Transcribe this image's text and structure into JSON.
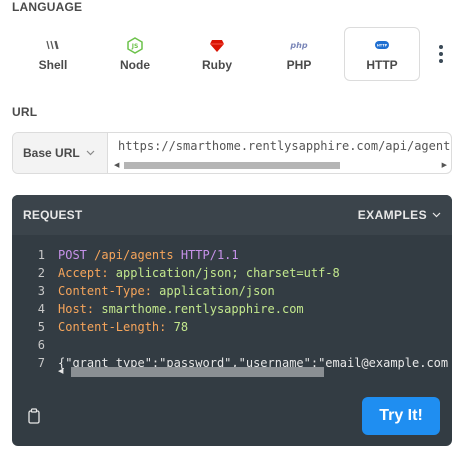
{
  "language_section": {
    "title": "LANGUAGE",
    "tabs": [
      {
        "label": "Shell",
        "icon": "shell-icon",
        "active": false
      },
      {
        "label": "Node",
        "icon": "nodejs-icon",
        "active": false
      },
      {
        "label": "Ruby",
        "icon": "ruby-icon",
        "active": false
      },
      {
        "label": "PHP",
        "icon": "php-icon",
        "active": false
      },
      {
        "label": "HTTP",
        "icon": "http-icon",
        "active": true
      }
    ],
    "more_icon": "kebab-menu-icon"
  },
  "url_section": {
    "title": "URL",
    "base_url_label": "Base URL",
    "url_value": "https://smarthome.rentlysapphire.com/api/agent"
  },
  "request_panel": {
    "title": "REQUEST",
    "examples_label": "EXAMPLES",
    "lines": [
      {
        "num": "1",
        "parts": [
          {
            "t": "POST ",
            "c": "kw"
          },
          {
            "t": "/api/agents ",
            "c": "hk"
          },
          {
            "t": "HTTP/1.1",
            "c": "kw"
          }
        ]
      },
      {
        "num": "2",
        "parts": [
          {
            "t": "Accept: ",
            "c": "hk"
          },
          {
            "t": "application/json; charset=utf-8",
            "c": "hv"
          }
        ]
      },
      {
        "num": "3",
        "parts": [
          {
            "t": "Content-Type: ",
            "c": "hk"
          },
          {
            "t": "application/json",
            "c": "hv"
          }
        ]
      },
      {
        "num": "4",
        "parts": [
          {
            "t": "Host: ",
            "c": "hk"
          },
          {
            "t": "smarthome.rentlysapphire.com",
            "c": "hv"
          }
        ]
      },
      {
        "num": "5",
        "parts": [
          {
            "t": "Content-Length: ",
            "c": "hk"
          },
          {
            "t": "78",
            "c": "hv"
          }
        ]
      },
      {
        "num": "6",
        "parts": []
      },
      {
        "num": "7",
        "parts": [
          {
            "t": "{\"grant_type\":\"password\",\"username\":\"email@example.com",
            "c": "pl"
          }
        ]
      }
    ],
    "copy_icon": "clipboard-icon",
    "try_label": "Try It!"
  },
  "colors": {
    "accent": "#1f8ef1",
    "panel_bg": "#333c43",
    "keyword": "#c792ea",
    "header_key": "#f6a55b",
    "header_value": "#c3e88d"
  }
}
